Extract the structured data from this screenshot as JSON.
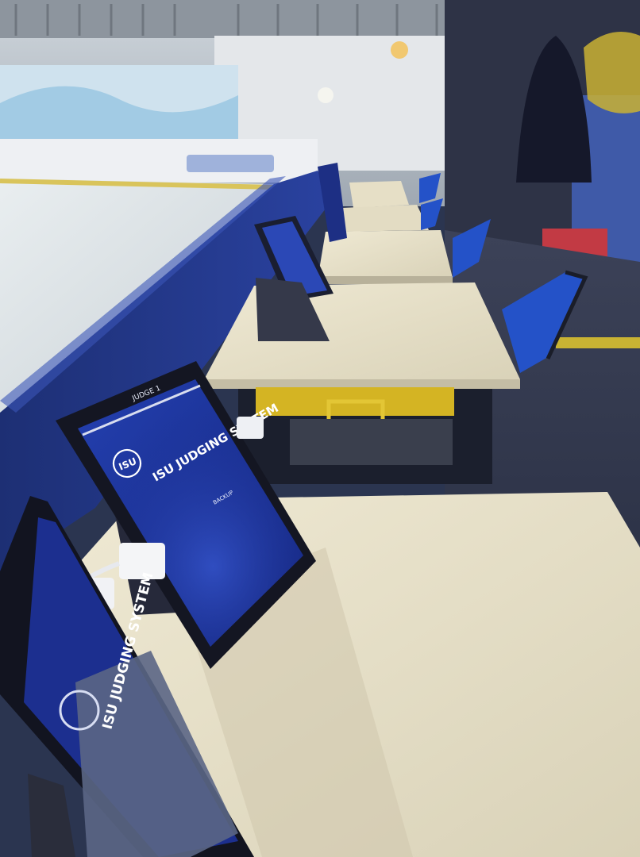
{
  "photo": {
    "tablet_main": {
      "header_label": "JUDGE 1",
      "logo_text": "ISU",
      "title": "ISU JUDGING SYSTEM",
      "button_label": "BACKUP"
    },
    "tablet_front": {
      "title": "ISU JUDGING SYSTEM"
    },
    "colors": {
      "rink_board_blue": "#243a8c",
      "tablet_screen_blue": "#1c2f8f",
      "desk_surface": "#e8e2cc",
      "chair_blue": "#2452c8",
      "drawer_yellow": "#d4b423"
    }
  }
}
